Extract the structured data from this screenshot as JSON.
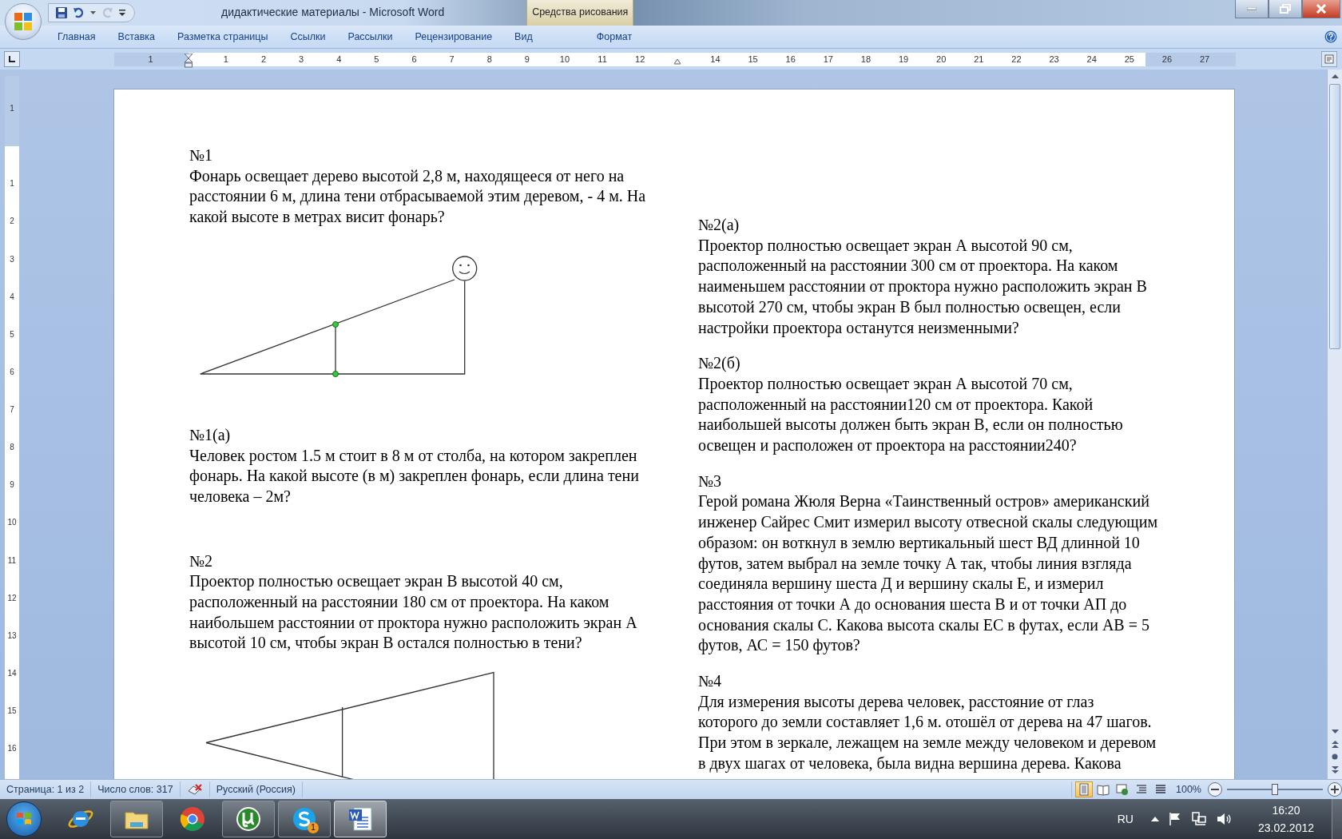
{
  "window": {
    "title": "дидактические материалы - Microsoft Word",
    "contextual_group": {
      "label": "Средства рисования",
      "tabs": [
        {
          "label": "Формат",
          "selected": false
        }
      ]
    }
  },
  "quick_access": [
    {
      "kind": "save",
      "disabled": false
    },
    {
      "kind": "undo",
      "disabled": false
    },
    {
      "kind": "dropdown",
      "disabled": false
    },
    {
      "kind": "redo",
      "disabled": true
    },
    {
      "kind": "customize",
      "disabled": false
    }
  ],
  "ribbon_tabs": [
    {
      "label": "Главная",
      "selected": false
    },
    {
      "label": "Вставка",
      "selected": false
    },
    {
      "label": "Разметка страницы",
      "selected": false
    },
    {
      "label": "Ссылки",
      "selected": false
    },
    {
      "label": "Рассылки",
      "selected": false
    },
    {
      "label": "Рецензирование",
      "selected": false
    },
    {
      "label": "Вид",
      "selected": false
    }
  ],
  "ruler": {
    "horizontal": [
      "1",
      "1",
      "2",
      "3",
      "4",
      "5",
      "6",
      "7",
      "8",
      "9",
      "10",
      "11",
      "12",
      "14",
      "15",
      "16",
      "17",
      "18",
      "19",
      "20",
      "21",
      "22",
      "23",
      "24",
      "25",
      "26",
      "27"
    ],
    "vertical": [
      "1",
      "1",
      "2",
      "3",
      "4",
      "5",
      "6",
      "7",
      "8",
      "9",
      "10",
      "11",
      "12",
      "13",
      "14",
      "15",
      "16"
    ]
  },
  "document": {
    "columns": [
      [
        {
          "kind": "heading",
          "text": "№1"
        },
        {
          "kind": "paragraph",
          "text": "Фонарь освещает дерево высотой 2,8 м, находящееся от него на\nрасстоянии 6 м, длина тени отбрасываемой этим деревом, - 4 м. На\nкакой высоте в метрах висит фонарь?"
        },
        {
          "kind": "lamp-figure"
        },
        {
          "kind": "heading",
          "text": "№1(а)"
        },
        {
          "kind": "paragraph",
          "text": "Человек ростом 1.5 м стоит в 8 м от столба, на котором закреплен\nфонарь. На какой высоте (в м) закреплен фонарь, если длина тени\nчеловека – 2м?"
        },
        {
          "kind": "heading",
          "text": "№2"
        },
        {
          "kind": "paragraph",
          "text": "Проектор полностью освещает экран В высотой 40 см,\nрасположенный на расстоянии 180 см от проектора. На каком\nнаибольшем расстоянии от проктора нужно расположить экран А\nвысотой 10 см, чтобы экран В остался полностью в тени?"
        },
        {
          "kind": "projector-figure"
        }
      ],
      [
        {
          "kind": "heading",
          "text": "№2(а)"
        },
        {
          "kind": "paragraph",
          "text": "Проектор полностью освещает экран А высотой 90 см,\nрасположенный на расстоянии 300 см от проектора. На каком\nнаименьшем расстоянии от проктора нужно расположить экран В\nвысотой 270 см, чтобы экран В был полностью освещен, если\nнастройки проектора останутся неизменными?"
        },
        {
          "kind": "heading",
          "text": "№2(б)"
        },
        {
          "kind": "paragraph",
          "text": "Проектор полностью освещает экран А высотой 70 см,\nрасположенный на расстоянии120 см от проектора. Какой\nнаибольшей высоты должен быть экран В, если он полностью\nосвещен и расположен от проектора на расстоянии240?"
        },
        {
          "kind": "heading",
          "text": "№3"
        },
        {
          "kind": "paragraph",
          "text": "Герой романа Жюля Верна «Таинственный остров» американский\nинженер Сайрес Смит измерил высоту отвесной скалы следующим\nобразом: он воткнул в землю вертикальный шест ВД длинной 10\nфутов, затем выбрал на земле точку А так, чтобы линия взгляда\nсоединяла вершину шеста Д и вершину скалы Е, и измерил\nрасстояния от точки А до основания шеста В и от точки АП до\nоснования скалы С. Какова высота скалы ЕС в футах, если АВ = 5\nфутов, АС = 150 футов?"
        },
        {
          "kind": "heading",
          "text": "№4"
        },
        {
          "kind": "paragraph",
          "text": "Для измерения высоты дерева человек, расстояние от глаз\nкоторого до земли составляет 1,6 м. отошёл от дерева на 47 шагов.\nПри этом в зеркале, лежащем на земле между человеком и деревом\nв двух шагах от человека, была видна вершина дерева. Какова"
        }
      ]
    ]
  },
  "status_bar": {
    "page": "Страница: 1 из 2",
    "words": "Число слов: 317",
    "language": "Русский (Россия)",
    "view_buttons": [
      {
        "kind": "page",
        "selected": true
      },
      {
        "kind": "book",
        "selected": false
      },
      {
        "kind": "web",
        "selected": false
      },
      {
        "kind": "outline",
        "selected": false
      },
      {
        "kind": "draft",
        "selected": false
      }
    ],
    "zoom": "100%",
    "zoom_slider": {
      "level": 0.5
    }
  },
  "taskbar": {
    "apps": [
      {
        "kind": "e-globe",
        "running": false,
        "selected": false
      },
      {
        "kind": "folder",
        "running": true,
        "selected": false
      },
      {
        "kind": "round-browser",
        "running": false,
        "selected": false
      },
      {
        "kind": "mu-circle",
        "running": true,
        "selected": false
      },
      {
        "kind": "s-cloud",
        "running": true,
        "selected": false,
        "badge": "1"
      },
      {
        "kind": "w-document",
        "running": true,
        "selected": true
      }
    ]
  },
  "tray": {
    "language": "RU",
    "time": "16:20",
    "date": "23.02.2012"
  }
}
